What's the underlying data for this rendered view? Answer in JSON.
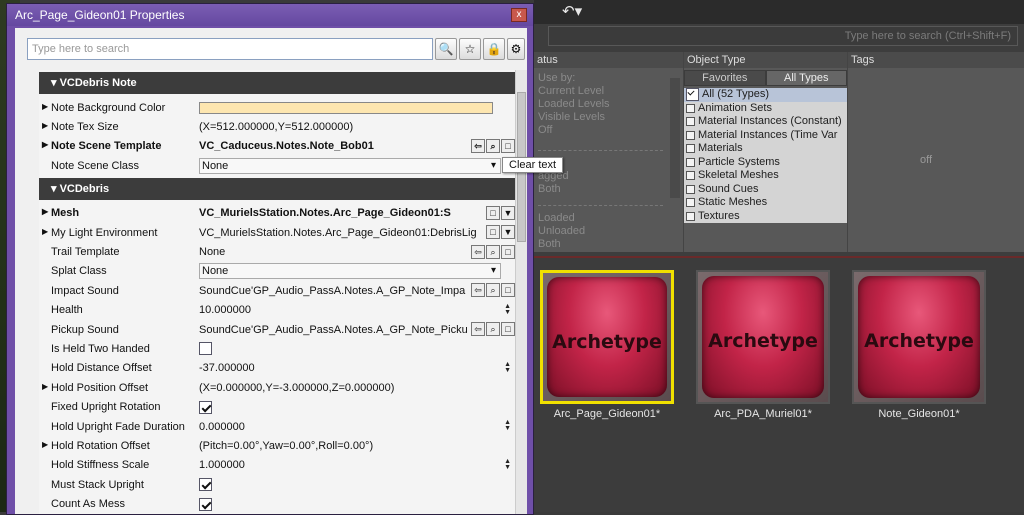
{
  "window": {
    "title": "Arc_Page_Gideon01 Properties",
    "close": "x"
  },
  "search": {
    "placeholder": "Type here to search"
  },
  "tooltip": "Clear text",
  "categories": {
    "note": "VCDebris Note",
    "debris": "VCDebris"
  },
  "note_props": [
    {
      "name": "Note Background Color",
      "value": ""
    },
    {
      "name": "Note Tex Size",
      "value": "(X=512.000000,Y=512.000000)"
    },
    {
      "name": "Note Scene Template",
      "value": "VC_Caduceus.Notes.Note_Bob01"
    },
    {
      "name": "Note Scene Class",
      "value": "None"
    }
  ],
  "debris_props": [
    {
      "name": "Mesh",
      "value": "VC_MurielsStation.Notes.Arc_Page_Gideon01:S"
    },
    {
      "name": "My Light Environment",
      "value": "VC_MurielsStation.Notes.Arc_Page_Gideon01:DebrisLig"
    },
    {
      "name": "Trail Template",
      "value": "None"
    },
    {
      "name": "Splat Class",
      "value": "None"
    },
    {
      "name": "Impact Sound",
      "value": "SoundCue'GP_Audio_PassA.Notes.A_GP_Note_Impa"
    },
    {
      "name": "Health",
      "value": "10.000000"
    },
    {
      "name": "Pickup Sound",
      "value": "SoundCue'GP_Audio_PassA.Notes.A_GP_Note_Picku"
    },
    {
      "name": "Is Held Two Handed",
      "value": ""
    },
    {
      "name": "Hold Distance Offset",
      "value": "-37.000000"
    },
    {
      "name": "Hold Position Offset",
      "value": "(X=0.000000,Y=-3.000000,Z=0.000000)"
    },
    {
      "name": "Fixed Upright Rotation",
      "value": ""
    },
    {
      "name": "Hold Upright Fade Duration",
      "value": "0.000000"
    },
    {
      "name": "Hold Rotation Offset",
      "value": "(Pitch=0.00°,Yaw=0.00°,Roll=0.00°)"
    },
    {
      "name": "Hold Stiffness Scale",
      "value": "1.000000"
    },
    {
      "name": "Must Stack Upright",
      "value": ""
    },
    {
      "name": "Count As Mess",
      "value": ""
    }
  ],
  "browser": {
    "search_placeholder": "Type here to search  (Ctrl+Shift+F)",
    "status_header": "atus",
    "status_items": [
      "Use by:",
      "Current Level",
      "Loaded Levels",
      "Visible Levels",
      "Off",
      "ed",
      "agged",
      "Both",
      "Loaded",
      "Unloaded",
      "Both"
    ],
    "object_type_header": "Object Type",
    "tabs": [
      "Favorites",
      "All Types"
    ],
    "types": [
      "All (52 Types)",
      "Animation Sets",
      "Material Instances (Constant)",
      "Material Instances (Time Var",
      "Materials",
      "Particle Systems",
      "Skeletal Meshes",
      "Sound Cues",
      "Static Meshes",
      "Textures"
    ],
    "tags_header": "Tags",
    "tags_off": "off",
    "thumb_text": "Archetype",
    "assets": [
      "Arc_Page_Gideon01*",
      "Arc_PDA_Muriel01*",
      "Note_Gideon01*"
    ]
  }
}
